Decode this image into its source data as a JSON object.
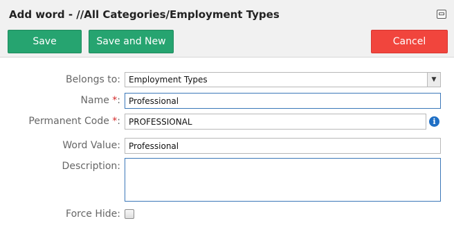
{
  "dialog": {
    "title": "Add word - //All Categories/Employment Types",
    "maximize_icon": "maximize-icon"
  },
  "toolbar": {
    "save_label": "Save",
    "save_new_label": "Save and New",
    "cancel_label": "Cancel"
  },
  "colors": {
    "save": "#26a470",
    "cancel": "#f1453d",
    "required": "#d42a2a",
    "info": "#1f6fc5"
  },
  "form": {
    "belongs_to": {
      "label": "Belongs to:",
      "value": "Employment Types"
    },
    "name": {
      "label": "Name ",
      "required_mark": "*",
      "colon": ":",
      "value": "Professional"
    },
    "permanent_code": {
      "label": "Permanent Code ",
      "required_mark": "*",
      "colon": ":",
      "value": "PROFESSIONAL",
      "icon": "info-icon"
    },
    "word_value": {
      "label": "Word Value:",
      "value": "Professional"
    },
    "description": {
      "label": "Description:",
      "value": ""
    },
    "force_hide": {
      "label": "Force Hide:",
      "checked": false
    }
  }
}
